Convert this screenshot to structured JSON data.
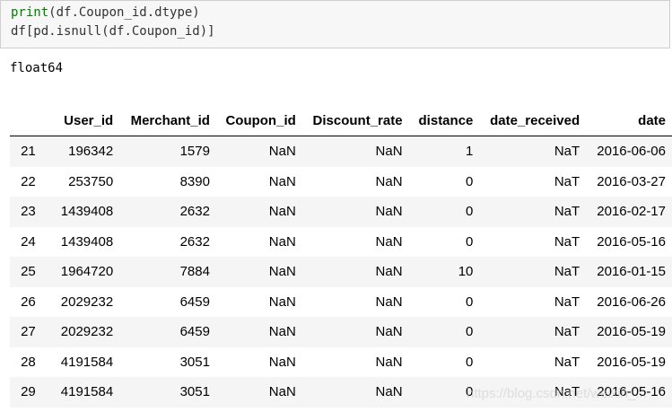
{
  "code_cell": {
    "line1": {
      "func": "print",
      "rest": "(df.Coupon_id.dtype)"
    },
    "line2": {
      "pre": "df[pd.",
      "func": "isnull",
      "rest": "(df.Coupon_id)]"
    }
  },
  "output": {
    "dtype_text": "float64"
  },
  "table": {
    "columns": [
      "",
      "User_id",
      "Merchant_id",
      "Coupon_id",
      "Discount_rate",
      "distance",
      "date_received",
      "date"
    ],
    "rows": [
      [
        "21",
        "196342",
        "1579",
        "NaN",
        "NaN",
        "1",
        "NaT",
        "2016-06-06"
      ],
      [
        "22",
        "253750",
        "8390",
        "NaN",
        "NaN",
        "0",
        "NaT",
        "2016-03-27"
      ],
      [
        "23",
        "1439408",
        "2632",
        "NaN",
        "NaN",
        "0",
        "NaT",
        "2016-02-17"
      ],
      [
        "24",
        "1439408",
        "2632",
        "NaN",
        "NaN",
        "0",
        "NaT",
        "2016-05-16"
      ],
      [
        "25",
        "1964720",
        "7884",
        "NaN",
        "NaN",
        "10",
        "NaT",
        "2016-01-15"
      ],
      [
        "26",
        "2029232",
        "6459",
        "NaN",
        "NaN",
        "0",
        "NaT",
        "2016-06-26"
      ],
      [
        "27",
        "2029232",
        "6459",
        "NaN",
        "NaN",
        "0",
        "NaT",
        "2016-05-19"
      ],
      [
        "28",
        "4191584",
        "3051",
        "NaN",
        "NaN",
        "0",
        "NaT",
        "2016-05-19"
      ],
      [
        "29",
        "4191584",
        "3051",
        "NaN",
        "NaN",
        "0",
        "NaT",
        "2016-05-16"
      ]
    ]
  },
  "colors": {
    "code_background": "#f7f7f7",
    "builtin_green": "#008000",
    "row_stripe": "#f5f5f5"
  },
  "watermark": {
    "text": "https://blog.csdn.net/weixin_..."
  }
}
